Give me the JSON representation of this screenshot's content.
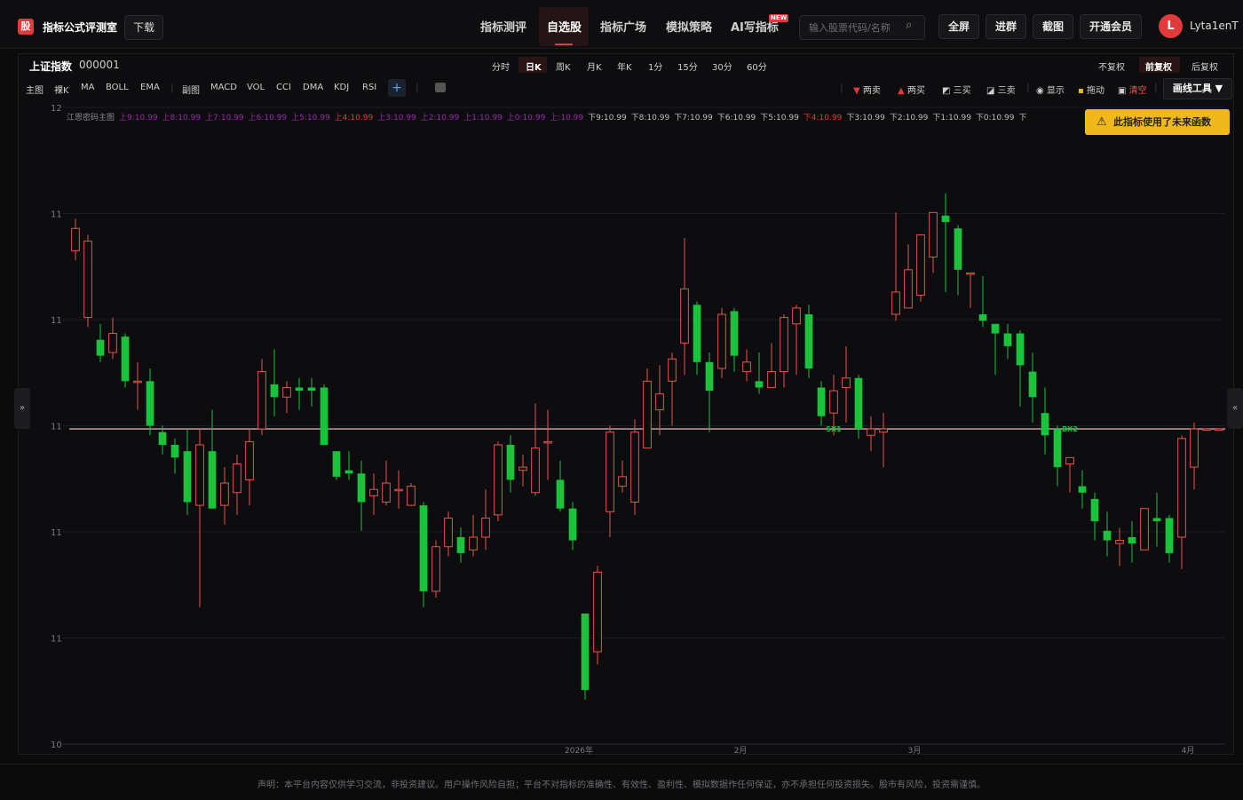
{
  "header": {
    "logo_char": "股",
    "brand": "指标公式评测室",
    "download": "下载",
    "nav": [
      "指标测评",
      "自选股",
      "指标广场",
      "模拟策略",
      "AI写指标"
    ],
    "new_badge": "NEW",
    "search_placeholder": "输入股票代码/名称",
    "buttons": [
      "全屏",
      "进群",
      "截图",
      "开通会员"
    ],
    "avatar_letter": "L",
    "username": "Lyta1enT"
  },
  "stock": {
    "name": "上证指数",
    "code": "000001"
  },
  "periods": [
    "分时",
    "日K",
    "周K",
    "月K",
    "年K",
    "1分",
    "15分",
    "30分",
    "60分"
  ],
  "active_period": "日K",
  "fuquan": [
    "不复权",
    "前复权",
    "后复权"
  ],
  "active_fuquan": "前复权",
  "indicators_main_label": "主图",
  "indicators_main": [
    "裸K",
    "MA",
    "BOLL",
    "EMA"
  ],
  "indicators_sub_label": "副图",
  "indicators_sub": [
    "MACD",
    "VOL",
    "CCI",
    "DMA",
    "KDJ",
    "RSI"
  ],
  "tools": [
    "两卖",
    "两买",
    "三买",
    "三卖",
    "显示",
    "拖动",
    "清空"
  ],
  "draw_tools": "画线工具 ▼",
  "warning": "此指标使用了未来函数",
  "legend": {
    "name": "江恩密码主图",
    "items": [
      {
        "t": "上9:10.99",
        "c": "#9c27b0"
      },
      {
        "t": "上8:10.99",
        "c": "#9c27b0"
      },
      {
        "t": "上7:10.99",
        "c": "#9c27b0"
      },
      {
        "t": "上6:10.99",
        "c": "#9c27b0"
      },
      {
        "t": "上5:10.99",
        "c": "#9c27b0"
      },
      {
        "t": "上4:10.99",
        "c": "#e53935"
      },
      {
        "t": "上3:10.99",
        "c": "#9c27b0"
      },
      {
        "t": "上2:10.99",
        "c": "#9c27b0"
      },
      {
        "t": "上1:10.99",
        "c": "#9c27b0"
      },
      {
        "t": "上0:10.99",
        "c": "#9c27b0"
      },
      {
        "t": "上:10.99",
        "c": "#9c27b0"
      },
      {
        "t": "下9:10.99",
        "c": "#bdbdbd"
      },
      {
        "t": "下8:10.99",
        "c": "#bdbdbd"
      },
      {
        "t": "下7:10.99",
        "c": "#bdbdbd"
      },
      {
        "t": "下6:10.99",
        "c": "#bdbdbd"
      },
      {
        "t": "下5:10.99",
        "c": "#bdbdbd"
      },
      {
        "t": "下4:10.99",
        "c": "#e53935"
      },
      {
        "t": "下3:10.99",
        "c": "#bdbdbd"
      },
      {
        "t": "下2:10.99",
        "c": "#bdbdbd"
      },
      {
        "t": "下1:10.99",
        "c": "#bdbdbd"
      },
      {
        "t": "下0:10.99",
        "c": "#bdbdbd"
      },
      {
        "t": "下",
        "c": "#bdbdbd"
      }
    ]
  },
  "chart_data": {
    "type": "candlestick",
    "y_tick_labels": [
      "12",
      "11",
      "11",
      "11",
      "11",
      "11",
      "10"
    ],
    "ylim": [
      10.0,
      12.0
    ],
    "x_tick_labels": [
      "2026年",
      "2月",
      "3月",
      "4月"
    ],
    "x_tick_index": [
      41,
      54,
      68,
      90
    ],
    "hline": 10.99,
    "markers": [
      {
        "text": "SX1",
        "index": 61,
        "value": 10.99
      },
      {
        "text": "BX2",
        "index": 80,
        "value": 10.99
      }
    ],
    "colors": {
      "up": "#e2564e",
      "down": "#19c43c",
      "line": "#d7a7b4",
      "marker": "#19c43c"
    },
    "candles": [
      [
        11.55,
        11.62,
        11.65,
        11.52
      ],
      [
        11.34,
        11.58,
        11.6,
        11.31
      ],
      [
        11.27,
        11.22,
        11.32,
        11.2
      ],
      [
        11.23,
        11.29,
        11.34,
        11.21
      ],
      [
        11.28,
        11.14,
        11.29,
        11.12
      ],
      [
        11.14,
        11.14,
        11.2,
        11.05
      ],
      [
        11.14,
        11.0,
        11.18,
        10.97
      ],
      [
        10.98,
        10.94,
        11.0,
        10.91
      ],
      [
        10.94,
        10.9,
        10.96,
        10.85
      ],
      [
        10.92,
        10.76,
        10.99,
        10.72
      ],
      [
        10.75,
        10.94,
        10.99,
        10.43
      ],
      [
        10.92,
        10.74,
        11.05,
        10.76
      ],
      [
        10.75,
        10.82,
        10.87,
        10.69
      ],
      [
        10.79,
        10.88,
        10.91,
        10.72
      ],
      [
        10.83,
        10.95,
        10.99,
        10.75
      ],
      [
        10.99,
        11.17,
        11.21,
        10.97
      ],
      [
        11.13,
        11.09,
        11.24,
        11.03
      ],
      [
        11.09,
        11.12,
        11.14,
        11.04
      ],
      [
        11.12,
        11.11,
        11.15,
        11.05
      ],
      [
        11.12,
        11.11,
        11.15,
        11.06
      ],
      [
        11.12,
        10.94,
        11.13,
        10.94
      ],
      [
        10.92,
        10.84,
        10.92,
        10.83
      ],
      [
        10.86,
        10.85,
        10.92,
        10.83
      ],
      [
        10.85,
        10.76,
        10.89,
        10.67
      ],
      [
        10.78,
        10.8,
        10.85,
        10.72
      ],
      [
        10.76,
        10.82,
        10.89,
        10.75
      ],
      [
        10.8,
        10.8,
        10.86,
        10.74
      ],
      [
        10.75,
        10.81,
        10.82,
        10.75
      ],
      [
        10.75,
        10.48,
        10.76,
        10.43
      ],
      [
        10.48,
        10.62,
        10.64,
        10.46
      ],
      [
        10.62,
        10.71,
        10.73,
        10.59
      ],
      [
        10.65,
        10.6,
        10.68,
        10.57
      ],
      [
        10.61,
        10.65,
        10.72,
        10.59
      ],
      [
        10.65,
        10.71,
        10.8,
        10.61
      ],
      [
        10.72,
        10.94,
        10.95,
        10.7
      ],
      [
        10.94,
        10.83,
        10.97,
        10.79
      ],
      [
        10.86,
        10.87,
        10.91,
        10.81
      ],
      [
        10.79,
        10.93,
        11.07,
        10.78
      ],
      [
        10.95,
        10.95,
        11.05,
        10.83
      ],
      [
        10.83,
        10.74,
        10.89,
        10.73
      ],
      [
        10.74,
        10.64,
        10.76,
        10.61
      ],
      [
        10.41,
        10.17,
        10.41,
        10.14
      ],
      [
        10.29,
        10.54,
        10.56,
        10.25
      ],
      [
        10.73,
        10.98,
        11.0,
        10.65
      ],
      [
        10.81,
        10.84,
        10.89,
        10.79
      ],
      [
        10.76,
        10.98,
        11.02,
        10.72
      ],
      [
        10.93,
        11.14,
        11.18,
        10.95
      ],
      [
        11.05,
        11.1,
        11.19,
        10.97
      ],
      [
        11.14,
        11.21,
        11.23,
        11.0
      ],
      [
        11.26,
        11.43,
        11.59,
        11.16
      ],
      [
        11.38,
        11.2,
        11.39,
        11.16
      ],
      [
        11.2,
        11.11,
        11.23,
        10.98
      ],
      [
        11.18,
        11.35,
        11.37,
        11.15
      ],
      [
        11.36,
        11.22,
        11.37,
        11.17
      ],
      [
        11.17,
        11.2,
        11.24,
        11.14
      ],
      [
        11.14,
        11.12,
        11.23,
        11.1
      ],
      [
        11.12,
        11.17,
        11.26,
        11.12
      ],
      [
        11.17,
        11.34,
        11.35,
        11.12
      ],
      [
        11.32,
        11.37,
        11.38,
        11.16
      ],
      [
        11.35,
        11.18,
        11.38,
        11.15
      ],
      [
        11.12,
        11.03,
        11.14,
        11.0
      ],
      [
        11.04,
        11.11,
        11.16,
        10.97
      ],
      [
        11.12,
        11.15,
        11.25,
        11.01
      ],
      [
        11.15,
        10.99,
        11.16,
        10.96
      ],
      [
        10.97,
        10.99,
        11.03,
        10.92
      ],
      [
        10.98,
        10.99,
        11.04,
        10.87
      ],
      [
        11.35,
        11.42,
        11.67,
        11.33
      ],
      [
        11.37,
        11.49,
        11.57,
        11.38
      ],
      [
        11.41,
        11.6,
        11.6,
        11.39
      ],
      [
        11.53,
        11.67,
        11.66,
        11.48
      ],
      [
        11.66,
        11.64,
        11.73,
        11.42
      ],
      [
        11.62,
        11.49,
        11.63,
        11.41
      ],
      [
        11.48,
        11.48,
        11.46,
        11.37
      ],
      [
        11.35,
        11.33,
        11.47,
        11.31
      ],
      [
        11.32,
        11.29,
        11.32,
        11.16
      ],
      [
        11.29,
        11.25,
        11.32,
        11.21
      ],
      [
        11.29,
        11.19,
        11.3,
        11.06
      ],
      [
        11.17,
        11.09,
        11.23,
        11.01
      ],
      [
        11.04,
        10.97,
        11.12,
        10.91
      ],
      [
        10.99,
        10.87,
        11.0,
        10.81
      ],
      [
        10.88,
        10.9,
        10.89,
        10.79
      ],
      [
        10.81,
        10.79,
        10.86,
        10.74
      ],
      [
        10.77,
        10.7,
        10.79,
        10.64
      ],
      [
        10.67,
        10.64,
        10.73,
        10.59
      ],
      [
        10.63,
        10.64,
        10.68,
        10.56
      ],
      [
        10.65,
        10.63,
        10.7,
        10.57
      ],
      [
        10.61,
        10.74,
        10.74,
        10.61
      ],
      [
        10.71,
        10.7,
        10.79,
        10.62
      ],
      [
        10.71,
        10.6,
        10.72,
        10.57
      ],
      [
        10.65,
        10.96,
        10.97,
        10.55
      ],
      [
        10.87,
        10.99,
        11.01,
        10.8
      ],
      [
        10.99,
        10.99,
        10.99,
        10.99
      ],
      [
        10.99,
        10.99,
        10.99,
        10.99
      ]
    ]
  },
  "footer": {
    "disclaimer": "声明：本平台内容仅供学习交流，非投资建议。用户操作风险自担；平台不对指标的准确性、有效性、盈利性、模拟数据作任何保证，亦不承担任何投资损失。股市有风险，投资需谨慎。"
  }
}
